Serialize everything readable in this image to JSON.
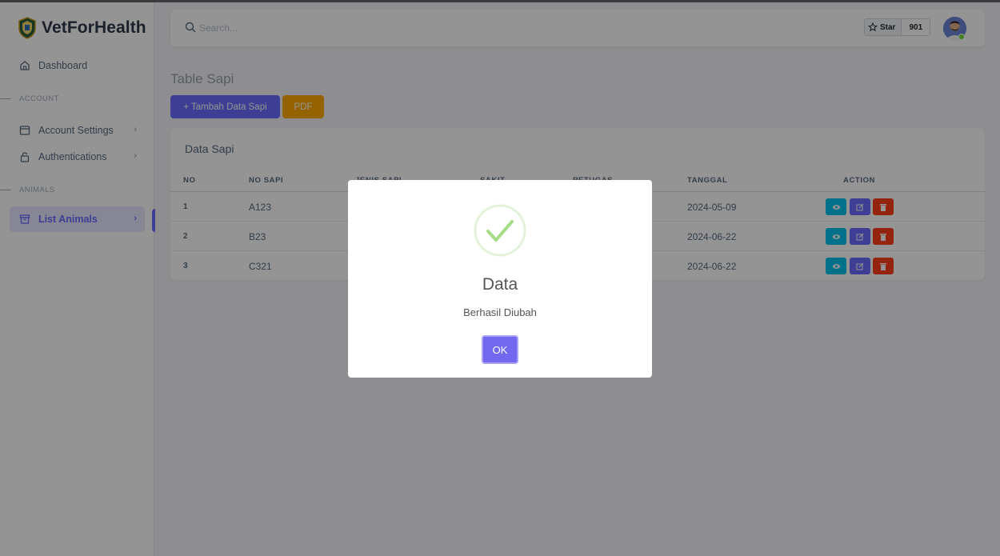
{
  "app": {
    "brand": "VetForHealth"
  },
  "sidebar": {
    "dashboard": "Dashboard",
    "header_account": "ACCOUNT",
    "account_settings": "Account Settings",
    "authentications": "Authentications",
    "header_animals": "ANIMALS",
    "list_animals": "List Animals"
  },
  "navbar": {
    "search_placeholder": "Search...",
    "star_label": "Star",
    "star_count": "901"
  },
  "page": {
    "title": "Table Sapi",
    "add_button": "+ Tambah Data Sapi",
    "pdf_button": "PDF"
  },
  "table": {
    "card_title": "Data Sapi",
    "headers": [
      "NO",
      "NO SAPI",
      "JENIS SAPI",
      "SAKIT",
      "PETUGAS",
      "TANGGAL",
      "ACTION"
    ],
    "rows": [
      {
        "no": "1",
        "no_sapi": "A123",
        "tanggal": "2024-05-09"
      },
      {
        "no": "2",
        "no_sapi": "B23",
        "tanggal": "2024-06-22"
      },
      {
        "no": "3",
        "no_sapi": "C321",
        "tanggal": "2024-06-22"
      }
    ]
  },
  "modal": {
    "title": "Data",
    "message": "Berhasil Diubah",
    "ok_label": "OK"
  },
  "colors": {
    "primary": "#696cff",
    "warning": "#ffab00",
    "info": "#03c3ec",
    "danger": "#ff3e1d",
    "success": "#a5dc86",
    "modal_button": "#7367f0"
  },
  "icons": {
    "search": "search-icon",
    "star": "star-icon",
    "view": "eye-icon",
    "edit": "edit-icon",
    "delete": "trash-icon",
    "success": "checkmark-icon"
  }
}
